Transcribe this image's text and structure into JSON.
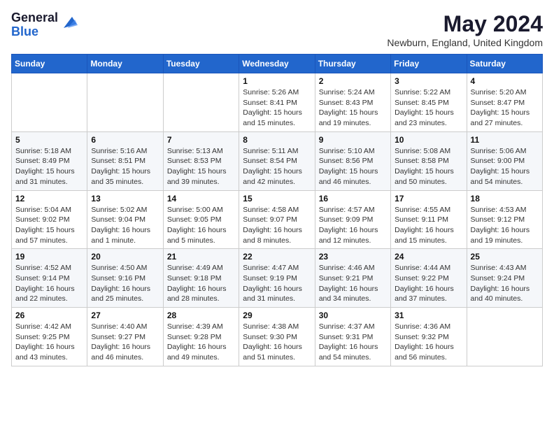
{
  "logo": {
    "general": "General",
    "blue": "Blue"
  },
  "title": "May 2024",
  "location": "Newburn, England, United Kingdom",
  "days_of_week": [
    "Sunday",
    "Monday",
    "Tuesday",
    "Wednesday",
    "Thursday",
    "Friday",
    "Saturday"
  ],
  "weeks": [
    [
      {
        "day": "",
        "info": ""
      },
      {
        "day": "",
        "info": ""
      },
      {
        "day": "",
        "info": ""
      },
      {
        "day": "1",
        "info": "Sunrise: 5:26 AM\nSunset: 8:41 PM\nDaylight: 15 hours\nand 15 minutes."
      },
      {
        "day": "2",
        "info": "Sunrise: 5:24 AM\nSunset: 8:43 PM\nDaylight: 15 hours\nand 19 minutes."
      },
      {
        "day": "3",
        "info": "Sunrise: 5:22 AM\nSunset: 8:45 PM\nDaylight: 15 hours\nand 23 minutes."
      },
      {
        "day": "4",
        "info": "Sunrise: 5:20 AM\nSunset: 8:47 PM\nDaylight: 15 hours\nand 27 minutes."
      }
    ],
    [
      {
        "day": "5",
        "info": "Sunrise: 5:18 AM\nSunset: 8:49 PM\nDaylight: 15 hours\nand 31 minutes."
      },
      {
        "day": "6",
        "info": "Sunrise: 5:16 AM\nSunset: 8:51 PM\nDaylight: 15 hours\nand 35 minutes."
      },
      {
        "day": "7",
        "info": "Sunrise: 5:13 AM\nSunset: 8:53 PM\nDaylight: 15 hours\nand 39 minutes."
      },
      {
        "day": "8",
        "info": "Sunrise: 5:11 AM\nSunset: 8:54 PM\nDaylight: 15 hours\nand 42 minutes."
      },
      {
        "day": "9",
        "info": "Sunrise: 5:10 AM\nSunset: 8:56 PM\nDaylight: 15 hours\nand 46 minutes."
      },
      {
        "day": "10",
        "info": "Sunrise: 5:08 AM\nSunset: 8:58 PM\nDaylight: 15 hours\nand 50 minutes."
      },
      {
        "day": "11",
        "info": "Sunrise: 5:06 AM\nSunset: 9:00 PM\nDaylight: 15 hours\nand 54 minutes."
      }
    ],
    [
      {
        "day": "12",
        "info": "Sunrise: 5:04 AM\nSunset: 9:02 PM\nDaylight: 15 hours\nand 57 minutes."
      },
      {
        "day": "13",
        "info": "Sunrise: 5:02 AM\nSunset: 9:04 PM\nDaylight: 16 hours\nand 1 minute."
      },
      {
        "day": "14",
        "info": "Sunrise: 5:00 AM\nSunset: 9:05 PM\nDaylight: 16 hours\nand 5 minutes."
      },
      {
        "day": "15",
        "info": "Sunrise: 4:58 AM\nSunset: 9:07 PM\nDaylight: 16 hours\nand 8 minutes."
      },
      {
        "day": "16",
        "info": "Sunrise: 4:57 AM\nSunset: 9:09 PM\nDaylight: 16 hours\nand 12 minutes."
      },
      {
        "day": "17",
        "info": "Sunrise: 4:55 AM\nSunset: 9:11 PM\nDaylight: 16 hours\nand 15 minutes."
      },
      {
        "day": "18",
        "info": "Sunrise: 4:53 AM\nSunset: 9:12 PM\nDaylight: 16 hours\nand 19 minutes."
      }
    ],
    [
      {
        "day": "19",
        "info": "Sunrise: 4:52 AM\nSunset: 9:14 PM\nDaylight: 16 hours\nand 22 minutes."
      },
      {
        "day": "20",
        "info": "Sunrise: 4:50 AM\nSunset: 9:16 PM\nDaylight: 16 hours\nand 25 minutes."
      },
      {
        "day": "21",
        "info": "Sunrise: 4:49 AM\nSunset: 9:18 PM\nDaylight: 16 hours\nand 28 minutes."
      },
      {
        "day": "22",
        "info": "Sunrise: 4:47 AM\nSunset: 9:19 PM\nDaylight: 16 hours\nand 31 minutes."
      },
      {
        "day": "23",
        "info": "Sunrise: 4:46 AM\nSunset: 9:21 PM\nDaylight: 16 hours\nand 34 minutes."
      },
      {
        "day": "24",
        "info": "Sunrise: 4:44 AM\nSunset: 9:22 PM\nDaylight: 16 hours\nand 37 minutes."
      },
      {
        "day": "25",
        "info": "Sunrise: 4:43 AM\nSunset: 9:24 PM\nDaylight: 16 hours\nand 40 minutes."
      }
    ],
    [
      {
        "day": "26",
        "info": "Sunrise: 4:42 AM\nSunset: 9:25 PM\nDaylight: 16 hours\nand 43 minutes."
      },
      {
        "day": "27",
        "info": "Sunrise: 4:40 AM\nSunset: 9:27 PM\nDaylight: 16 hours\nand 46 minutes."
      },
      {
        "day": "28",
        "info": "Sunrise: 4:39 AM\nSunset: 9:28 PM\nDaylight: 16 hours\nand 49 minutes."
      },
      {
        "day": "29",
        "info": "Sunrise: 4:38 AM\nSunset: 9:30 PM\nDaylight: 16 hours\nand 51 minutes."
      },
      {
        "day": "30",
        "info": "Sunrise: 4:37 AM\nSunset: 9:31 PM\nDaylight: 16 hours\nand 54 minutes."
      },
      {
        "day": "31",
        "info": "Sunrise: 4:36 AM\nSunset: 9:32 PM\nDaylight: 16 hours\nand 56 minutes."
      },
      {
        "day": "",
        "info": ""
      }
    ]
  ]
}
